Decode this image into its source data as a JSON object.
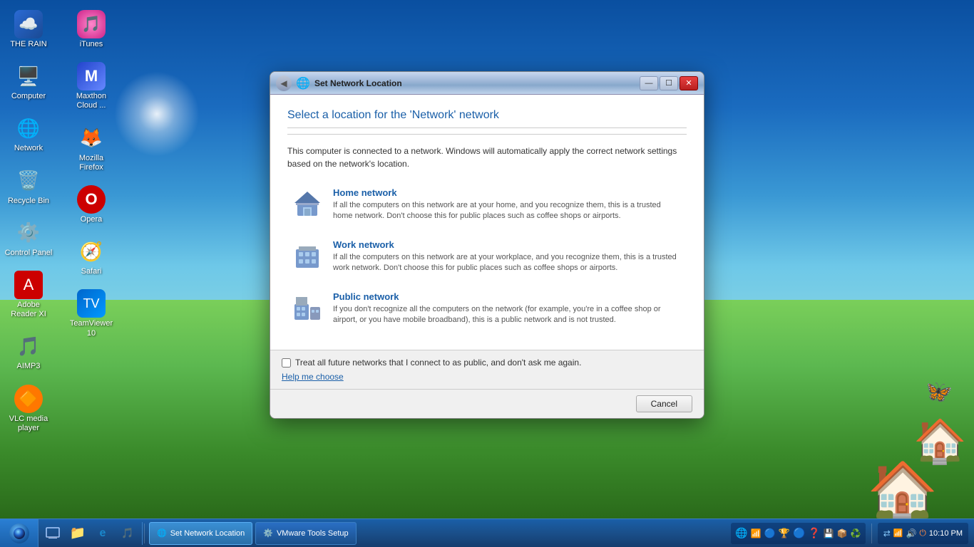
{
  "desktop": {
    "background": "Windows 7 style"
  },
  "icons_left": [
    {
      "id": "the-rain",
      "label": "THE RAIN",
      "emoji": "🌧️",
      "color": "#1a5fa8"
    },
    {
      "id": "computer",
      "label": "Computer",
      "emoji": "🖥️",
      "color": "#666"
    },
    {
      "id": "network",
      "label": "Network",
      "emoji": "🌐",
      "color": "#3a7fd4"
    },
    {
      "id": "recycle-bin",
      "label": "Recycle Bin",
      "emoji": "🗑️",
      "color": "#888"
    },
    {
      "id": "control-panel",
      "label": "Control Panel",
      "emoji": "⚙️",
      "color": "#888"
    },
    {
      "id": "adobe-reader",
      "label": "Adobe Reader XI",
      "emoji": "📕",
      "color": "#cc0000"
    },
    {
      "id": "aimp3",
      "label": "AIMP3",
      "emoji": "🎵",
      "color": "#3a7fd4"
    },
    {
      "id": "vlc",
      "label": "VLC media player",
      "emoji": "🔶",
      "color": "#ff7700"
    }
  ],
  "icons_right": [
    {
      "id": "itunes",
      "label": "iTunes",
      "emoji": "🎵",
      "color": "#cc55aa"
    },
    {
      "id": "maxthon",
      "label": "Maxthon Cloud ...",
      "emoji": "🌐",
      "color": "#3355cc"
    },
    {
      "id": "mozilla-firefox",
      "label": "Mozilla Firefox",
      "emoji": "🦊",
      "color": "#ff6600"
    },
    {
      "id": "opera",
      "label": "Opera",
      "emoji": "⭕",
      "color": "#cc0000"
    },
    {
      "id": "safari",
      "label": "Safari",
      "emoji": "🧭",
      "color": "#0099ff"
    },
    {
      "id": "teamviewer",
      "label": "TeamViewer 10",
      "emoji": "📡",
      "color": "#0099ff"
    }
  ],
  "dialog": {
    "title": "Set Network Location",
    "header": "Select a location for the 'Network' network",
    "description": "This computer is connected to a network. Windows will automatically apply the correct network settings based on the network's location.",
    "options": [
      {
        "id": "home-network",
        "title": "Home network",
        "desc": "If all the computers on this network are at your home, and you recognize them, this is a trusted home network.  Don't choose this for public places such as coffee shops or airports.",
        "icon": "🏠"
      },
      {
        "id": "work-network",
        "title": "Work network",
        "desc": "If all the computers on this network are at your workplace, and you recognize them, this is a trusted work network.  Don't choose this for public places such as coffee shops or airports.",
        "icon": "🏢"
      },
      {
        "id": "public-network",
        "title": "Public network",
        "desc": "If you don't recognize all the computers on the network (for example, you're in a coffee shop or airport, or you have mobile broadband), this is a public network and is not trusted.",
        "icon": "🏙️"
      }
    ],
    "checkbox_label": "Treat all future networks that I connect to as public, and don't ask me again.",
    "help_link": "Help me choose",
    "cancel_button": "Cancel"
  },
  "taskbar": {
    "items": [
      {
        "id": "set-network-location",
        "label": "Set Network Location",
        "active": true,
        "icon": "🌐"
      },
      {
        "id": "vmware-tools",
        "label": "VMware Tools Setup",
        "active": false,
        "icon": "⚙️"
      }
    ],
    "clock": "10:10 PM",
    "quick_launch": [
      "🌐",
      "📁",
      "🖥️"
    ]
  }
}
